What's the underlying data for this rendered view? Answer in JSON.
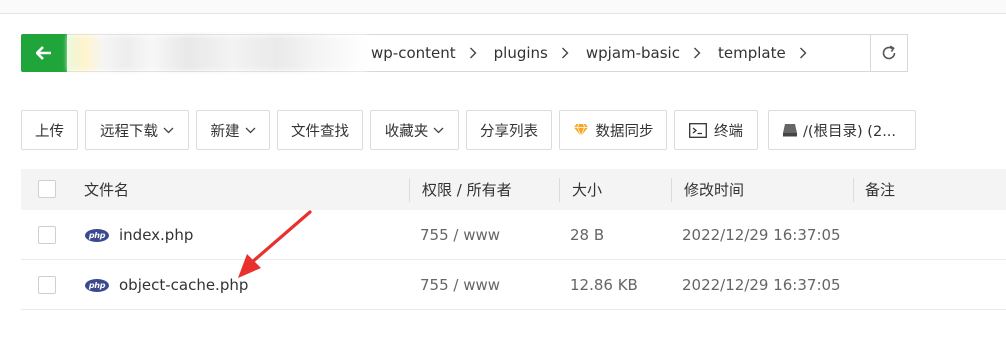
{
  "breadcrumb": {
    "items": [
      "wp-content",
      "plugins",
      "wpjam-basic",
      "template"
    ]
  },
  "toolbar": {
    "upload": "上传",
    "remote_download": "远程下载",
    "new": "新建",
    "file_search": "文件查找",
    "favorites": "收藏夹",
    "share_list": "分享列表",
    "data_sync": "数据同步",
    "terminal": "终端",
    "root_dir": "/(根目录) (2..."
  },
  "table": {
    "headers": {
      "name": "文件名",
      "permission": "权限 / 所有者",
      "size": "大小",
      "modified": "修改时间",
      "note": "备注"
    },
    "rows": [
      {
        "icon": "php",
        "name": "index.php",
        "permission": "755 / www",
        "size": "28 B",
        "modified": "2022/12/29 16:37:05"
      },
      {
        "icon": "php",
        "name": "object-cache.php",
        "permission": "755 / www",
        "size": "12.86 KB",
        "modified": "2022/12/29 16:37:05"
      }
    ]
  },
  "colors": {
    "accent": "#20a53a",
    "arrow": "#e8312f",
    "php_icon": "#3b4a8e",
    "sync_icon": "#f5a623"
  }
}
